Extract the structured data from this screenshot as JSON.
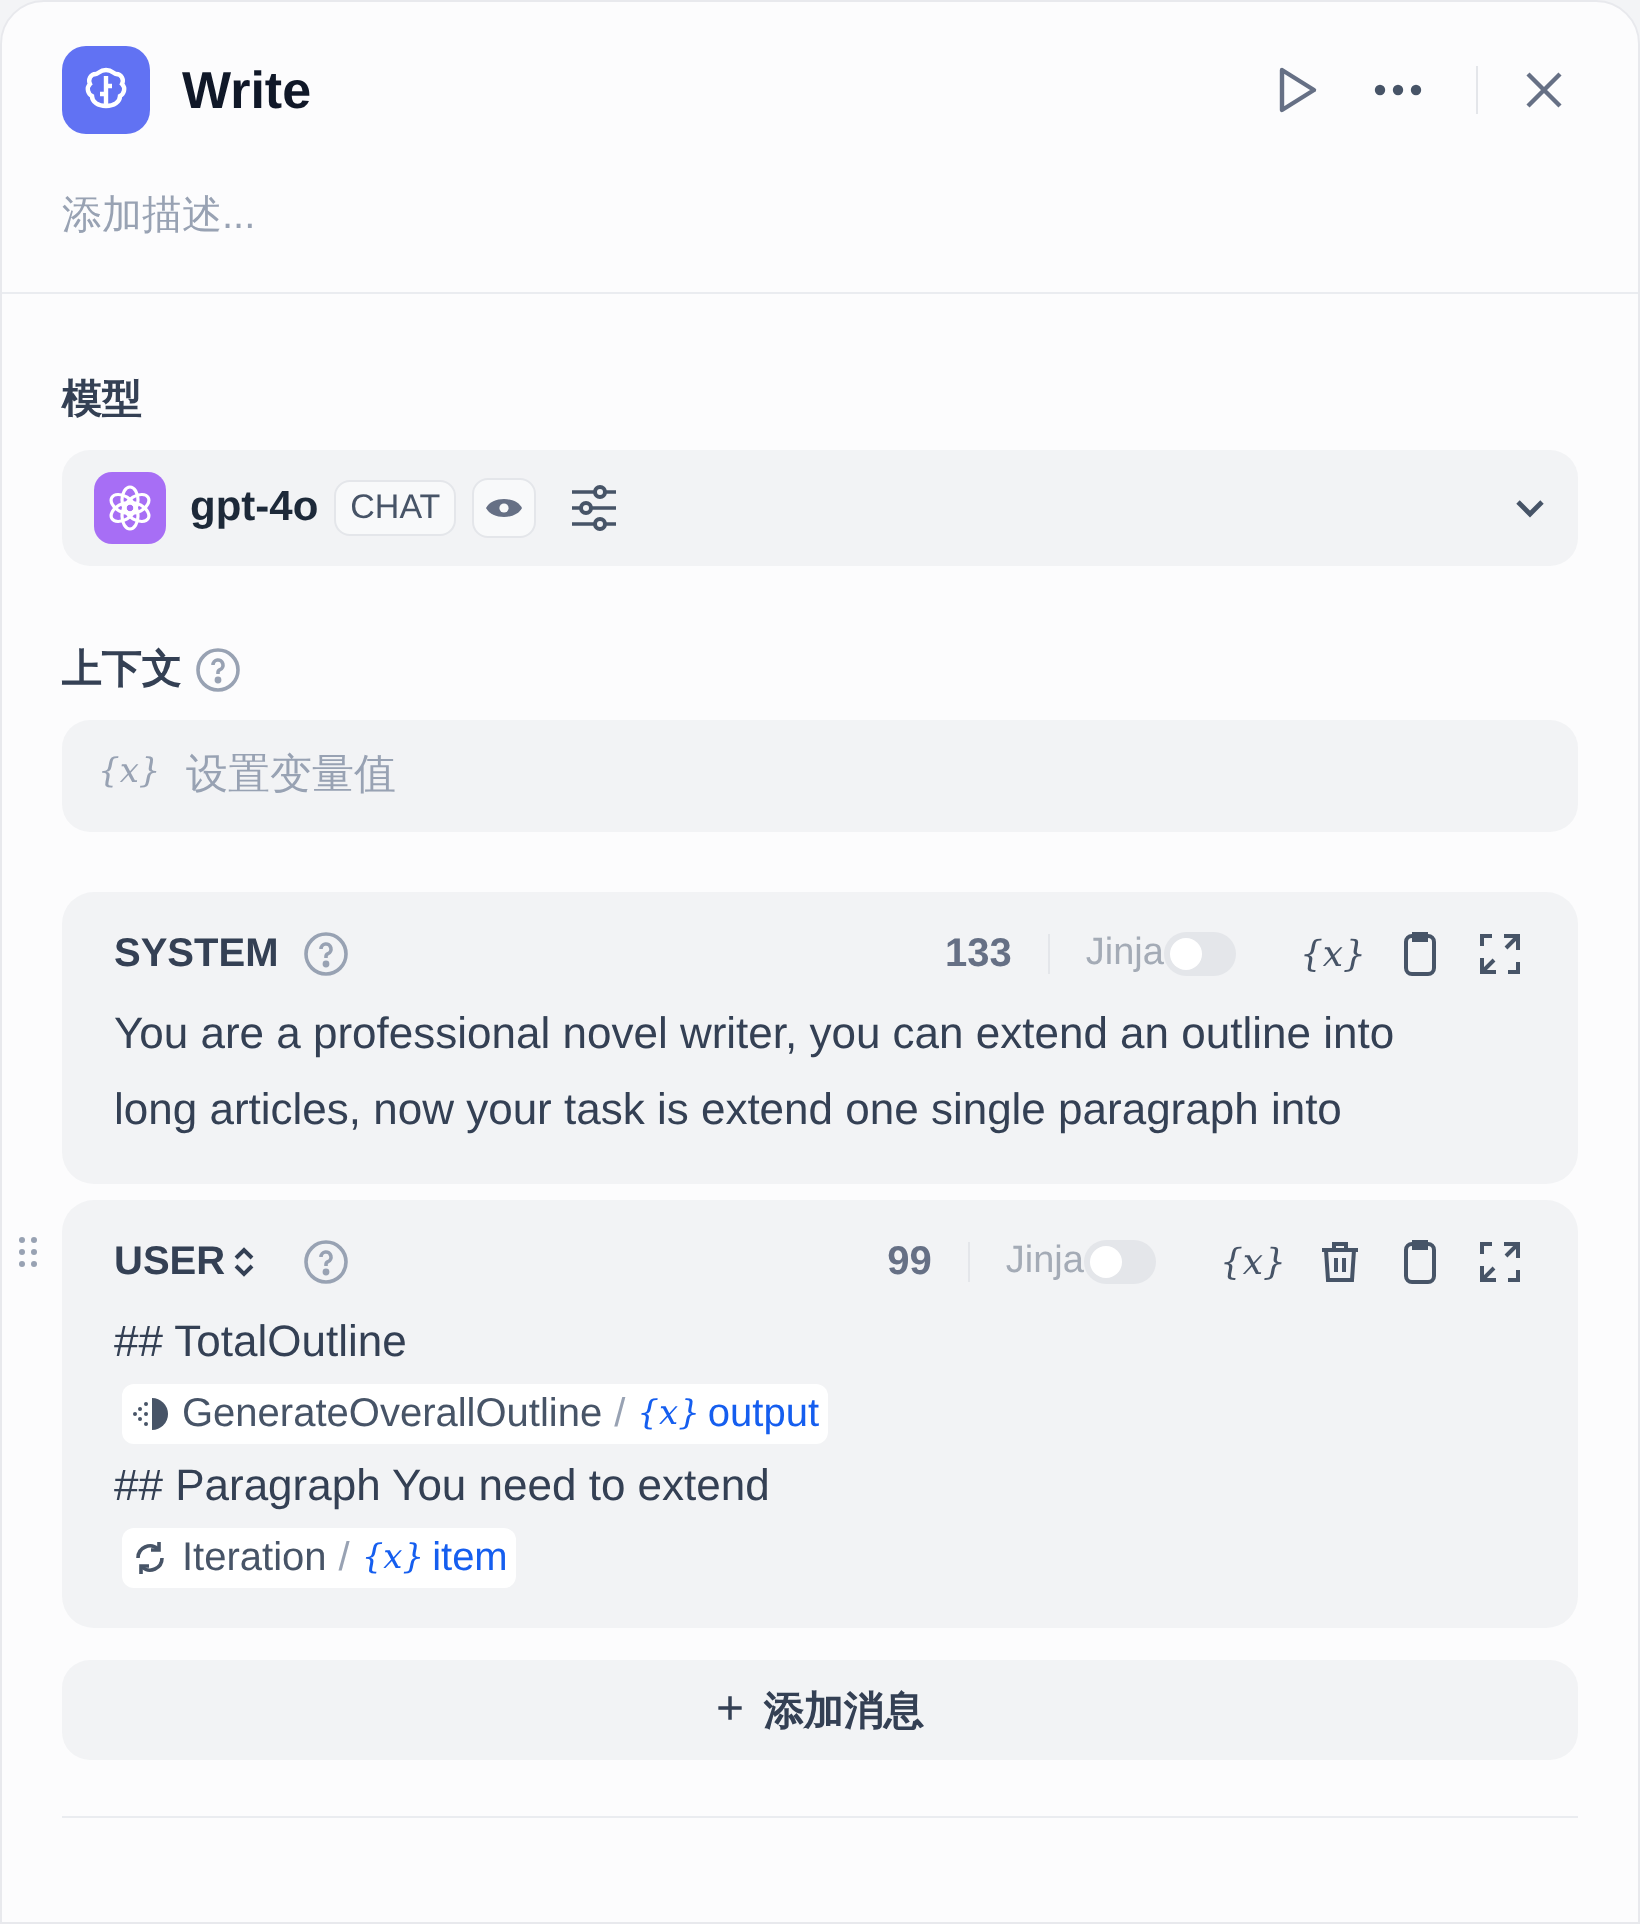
{
  "node": {
    "title": "Write",
    "description_placeholder": "添加描述..."
  },
  "model_section": {
    "label": "模型",
    "model": {
      "name": "gpt-4o",
      "mode": "CHAT",
      "vision": true
    }
  },
  "context_section": {
    "label": "上下文",
    "field": {
      "var_icon": "{x}",
      "placeholder": "设置变量值"
    }
  },
  "messages": [
    {
      "role": "SYSTEM",
      "role_switch": false,
      "count": "133",
      "jinja_label": "Jinja",
      "jinja_on": false,
      "var_button": "{x}",
      "deletable": false,
      "lines": [
        {
          "kind": "text",
          "text": "You are a professional novel writer, you can extend an outline into long articles, now your task is extend one single paragraph into"
        }
      ]
    },
    {
      "role": "USER",
      "role_switch": true,
      "count": "99",
      "jinja_label": "Jinja",
      "jinja_on": false,
      "var_button": "{x}",
      "deletable": true,
      "lines": [
        {
          "kind": "text",
          "text": "## TotalOutline"
        },
        {
          "kind": "variable",
          "node": {
            "kind": "llm",
            "name": "GenerateOverallOutline"
          },
          "separator": "/",
          "var_icon": "{x}",
          "variable": "output"
        },
        {
          "kind": "text",
          "text": "## Paragraph You need to extend"
        },
        {
          "kind": "variable",
          "node": {
            "kind": "iteration",
            "name": "Iteration"
          },
          "separator": "/",
          "var_icon": "{x}",
          "variable": "item"
        }
      ]
    }
  ],
  "add_message": {
    "icon": "+",
    "label": "添加消息"
  }
}
